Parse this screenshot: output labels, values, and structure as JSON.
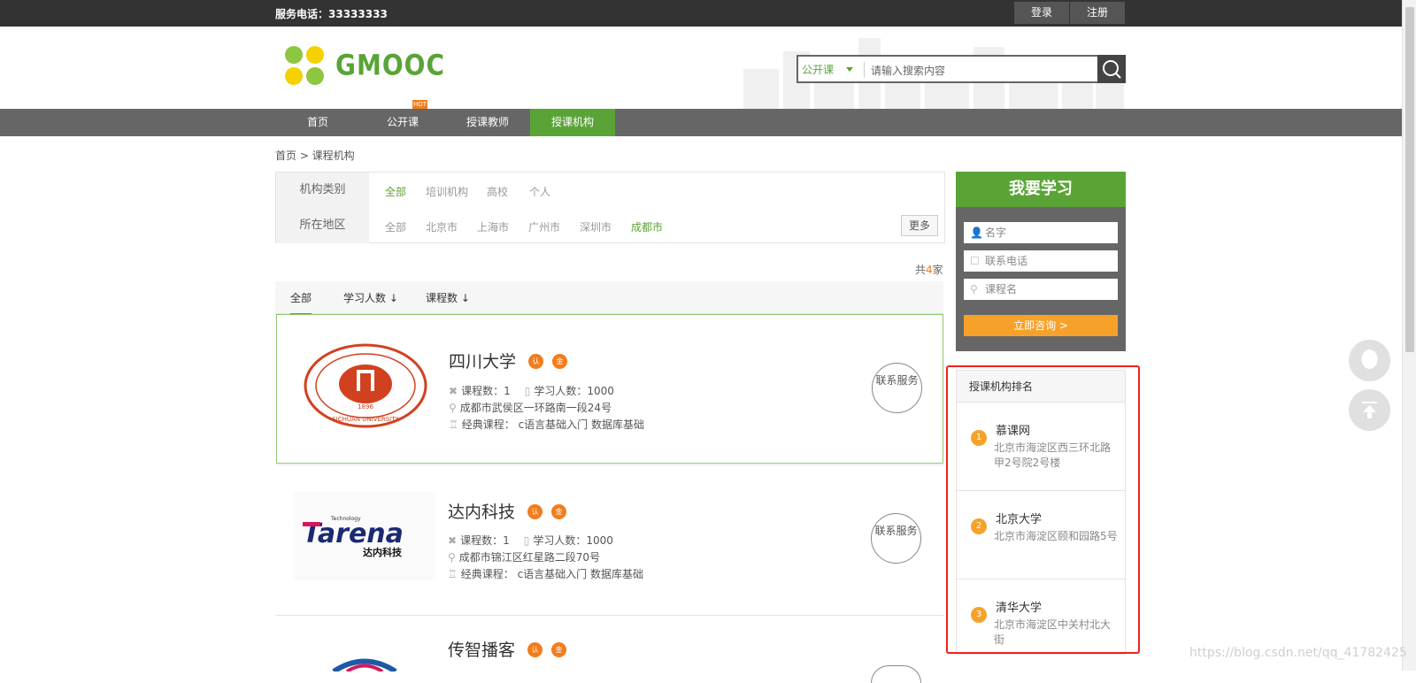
{
  "topbar": {
    "phone": "服务电话：33333333",
    "login": "登录",
    "register": "注册"
  },
  "header": {
    "logo_text": "GMOOC",
    "search_category": "公开课",
    "search_placeholder": "请输入搜索内容"
  },
  "nav": {
    "items": [
      "首页",
      "公开课",
      "授课教师",
      "授课机构"
    ],
    "hot_badge": "HOT",
    "active": "授课机构"
  },
  "breadcrumb": "首页 > 课程机构",
  "filters": {
    "category_label": "机构类别",
    "category_options": [
      "全部",
      "培训机构",
      "高校",
      "个人"
    ],
    "region_label": "所在地区",
    "region_options": [
      "全部",
      "北京市",
      "上海市",
      "广州市",
      "深圳市",
      "成都市"
    ],
    "more": "更多"
  },
  "total": {
    "prefix": "共",
    "count": "4",
    "suffix": "家"
  },
  "sort_tabs": [
    "全部",
    "学习人数 ↓",
    "课程数 ↓"
  ],
  "orgs": [
    {
      "name": "四川大学",
      "badge1": "认",
      "badge2": "金",
      "courses": "课程数：1",
      "students": "学习人数：1000",
      "address": "成都市武侯区一环路南一段24号",
      "classic": "经典课程：  c语言基础入门    数据库基础",
      "contact": "联系服务"
    },
    {
      "name": "达内科技",
      "badge1": "认",
      "badge2": "金",
      "courses": "课程数：1",
      "students": "学习人数：1000",
      "address": "成都市锦江区红星路二段70号",
      "classic": "经典课程：  c语言基础入门    数据库基础",
      "contact": "联系服务"
    },
    {
      "name": "传智播客",
      "badge1": "认",
      "badge2": "金"
    }
  ],
  "logos": {
    "sichuan_year": "1896",
    "sichuan_en": "SICHUAN UNIVERSITY",
    "tarena_small": "Technology",
    "tarena": "Tarena",
    "tarena_cn": "达内科技"
  },
  "sidebar": {
    "title": "我要学习",
    "name_ph": "名字",
    "phone_ph": "联系电话",
    "course_ph": "课程名",
    "submit": "立即咨询 >"
  },
  "ranking": {
    "title": "授课机构排名",
    "items": [
      {
        "rank": "1",
        "name": "慕课网",
        "address": "北京市海淀区西三环北路甲2号院2号楼"
      },
      {
        "rank": "2",
        "name": "北京大学",
        "address": "北京市海淀区颐和园路5号"
      },
      {
        "rank": "3",
        "name": "清华大学",
        "address": "北京市海淀区中关村北大街"
      }
    ]
  },
  "watermark": "https://blog.csdn.net/qq_41782425",
  "colors": {
    "brand_green": "#5aa437",
    "accent_orange": "#f37c1d",
    "highlight_red": "#e22222"
  }
}
